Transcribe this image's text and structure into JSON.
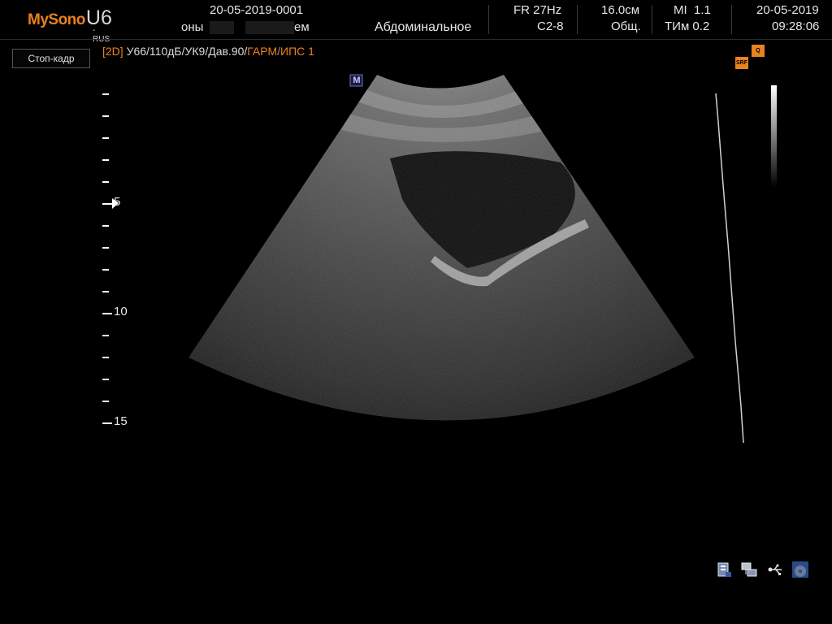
{
  "header": {
    "logo_brand": "MySono",
    "logo_model": "U6",
    "logo_suffix": "-RUS",
    "patient_id": "20-05-2019-0001",
    "patient_name_left": "оны",
    "patient_name_right": "ем",
    "exam_type": "Абдоминальное",
    "frame_rate": "FR 27Hz",
    "probe": "C2-8",
    "depth": "16.0см",
    "preset": "Общ.",
    "mi": "MI  1.1",
    "tim": "ТИм 0.2",
    "date": "20-05-2019",
    "time": "09:28:06"
  },
  "controls": {
    "freeze_label": "Стоп-кадр"
  },
  "imaging_params": {
    "mode": "[2D]",
    "gain_settings": " У66/110дБ/УК9/Дав.90/",
    "harmonic": "ГАРМ",
    "sep": "/",
    "ips": "ИПС 1"
  },
  "badges": {
    "srf": "SRF",
    "qsonic": "Q SONI"
  },
  "marker": "M",
  "depth_scale": {
    "labels": [
      "5",
      "10",
      "15"
    ]
  },
  "colors": {
    "accent": "#e8821e",
    "text": "#e6e6e6",
    "background": "#000000"
  },
  "icons": [
    "storage-icon",
    "network-icon",
    "usb-icon",
    "disc-icon"
  ]
}
